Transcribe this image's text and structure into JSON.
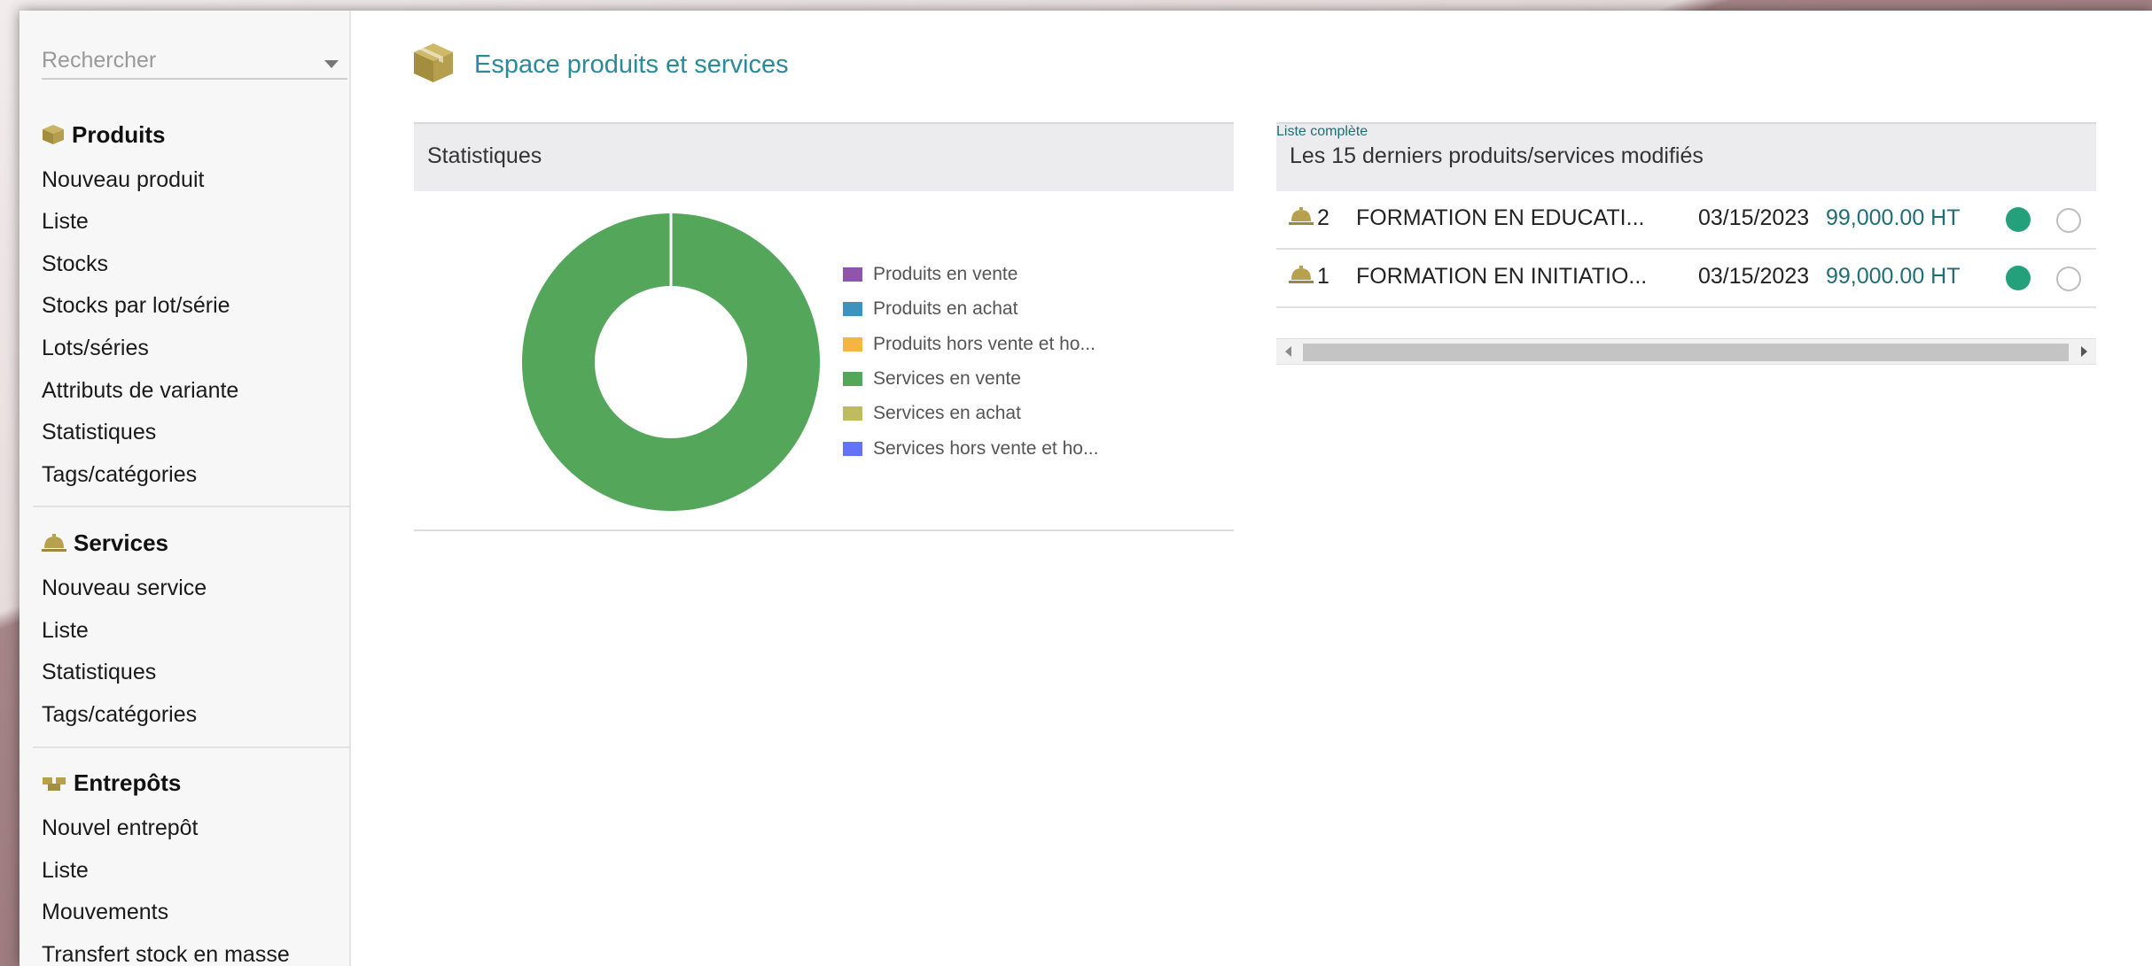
{
  "colors": {
    "accent_title": "#2a8a97",
    "price": "#1f6e75",
    "status_on": "#24a07a",
    "icon_gold": "#b8a14e"
  },
  "search": {
    "placeholder": "Rechercher"
  },
  "sidebar": {
    "produits": {
      "title": "Produits",
      "icon": "box-icon",
      "items": [
        "Nouveau produit",
        "Liste",
        "Stocks",
        "Stocks par lot/série",
        "Lots/séries",
        "Attributs de variante",
        "Statistiques",
        "Tags/catégories"
      ]
    },
    "services": {
      "title": "Services",
      "icon": "service-bell-icon",
      "items": [
        "Nouveau service",
        "Liste",
        "Statistiques",
        "Tags/catégories"
      ]
    },
    "entrepots": {
      "title": "Entrepôts",
      "icon": "warehouse-icon",
      "items": [
        "Nouvel entrepôt",
        "Liste",
        "Mouvements",
        "Transfert stock en masse"
      ]
    }
  },
  "header": {
    "title": "Espace produits et services",
    "icon": "box-icon"
  },
  "stats_panel": {
    "title": "Statistiques"
  },
  "chart_data": {
    "type": "pie",
    "donut": true,
    "categories": [
      "Produits en vente",
      "Produits en achat",
      "Produits hors vente et ho...",
      "Services en vente",
      "Services en achat",
      "Services hors vente et ho..."
    ],
    "values": [
      0,
      0,
      0,
      2,
      0,
      0
    ],
    "colors": [
      "#9055a9",
      "#3d93be",
      "#f6b443",
      "#53a65a",
      "#bfbc5f",
      "#6373f7"
    ],
    "legend": "right"
  },
  "recent_panel": {
    "title": "Les 15 derniers produits/services modifiés",
    "link": "Liste complète",
    "rows": [
      {
        "icon": "service-bell-icon",
        "ref": "2",
        "label": "FORMATION EN EDUCATI...",
        "date": "03/15/2023",
        "price": "99,000.00 HT",
        "status_sell": "on",
        "status_buy": "off"
      },
      {
        "icon": "service-bell-icon",
        "ref": "1",
        "label": "FORMATION EN INITIATIO...",
        "date": "03/15/2023",
        "price": "99,000.00 HT",
        "status_sell": "on",
        "status_buy": "off"
      }
    ]
  }
}
